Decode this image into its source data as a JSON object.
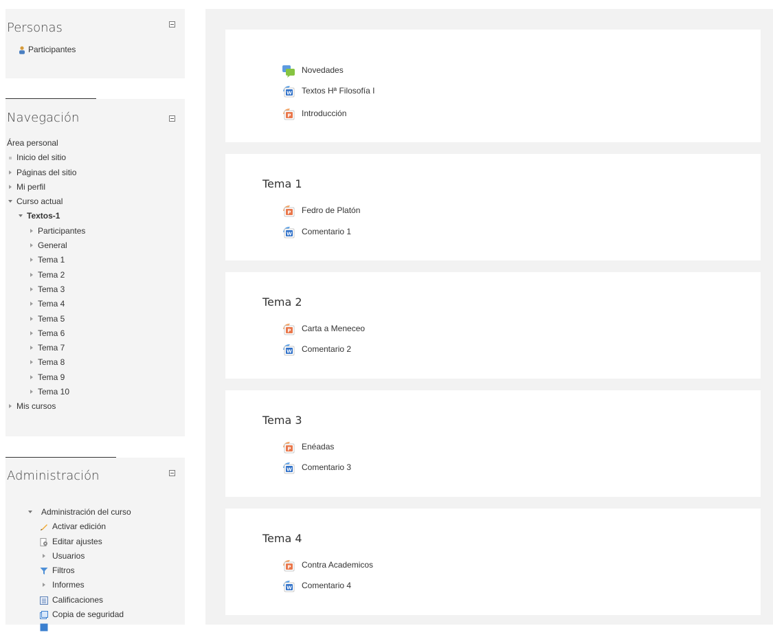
{
  "personas": {
    "title": "Personas",
    "participantes": "Participantes"
  },
  "navegacion": {
    "title": "Navegación",
    "area_personal": "Área personal",
    "inicio": "Inicio del sitio",
    "paginas": "Páginas del sitio",
    "perfil": "Mi perfil",
    "curso_actual": "Curso actual",
    "curso": "Textos-1",
    "curso_items": [
      "Participantes",
      "General",
      "Tema 1",
      "Tema 2",
      "Tema 3",
      "Tema 4",
      "Tema 5",
      "Tema 6",
      "Tema 7",
      "Tema 8",
      "Tema 9",
      "Tema 10"
    ],
    "mis_cursos": "Mis cursos"
  },
  "administracion": {
    "title": "Administración",
    "admin_curso": "Administración del curso",
    "items": [
      "Activar edición",
      "Editar ajustes",
      "Usuarios",
      "Filtros",
      "Informes",
      "Calificaciones",
      "Copia de seguridad"
    ]
  },
  "sections": [
    {
      "title": "",
      "activities": [
        {
          "icon": "forum-icon",
          "label": "Novedades"
        },
        {
          "icon": "word-document-icon",
          "label": "Textos Hª Filosofía I"
        },
        {
          "icon": "powerpoint-icon",
          "label": "Introducción"
        }
      ]
    },
    {
      "title": "Tema 1",
      "activities": [
        {
          "icon": "powerpoint-icon",
          "label": "Fedro de Platón"
        },
        {
          "icon": "word-document-icon",
          "label": "Comentario 1"
        }
      ]
    },
    {
      "title": "Tema 2",
      "activities": [
        {
          "icon": "powerpoint-icon",
          "label": "Carta a Meneceo"
        },
        {
          "icon": "word-document-icon",
          "label": "Comentario 2"
        }
      ]
    },
    {
      "title": "Tema 3",
      "activities": [
        {
          "icon": "powerpoint-icon",
          "label": "Enéadas"
        },
        {
          "icon": "word-document-icon",
          "label": "Comentario 3"
        }
      ]
    },
    {
      "title": "Tema 4",
      "activities": [
        {
          "icon": "powerpoint-icon",
          "label": "Contra Academicos"
        },
        {
          "icon": "word-document-icon",
          "label": "Comentario 4"
        }
      ]
    }
  ]
}
